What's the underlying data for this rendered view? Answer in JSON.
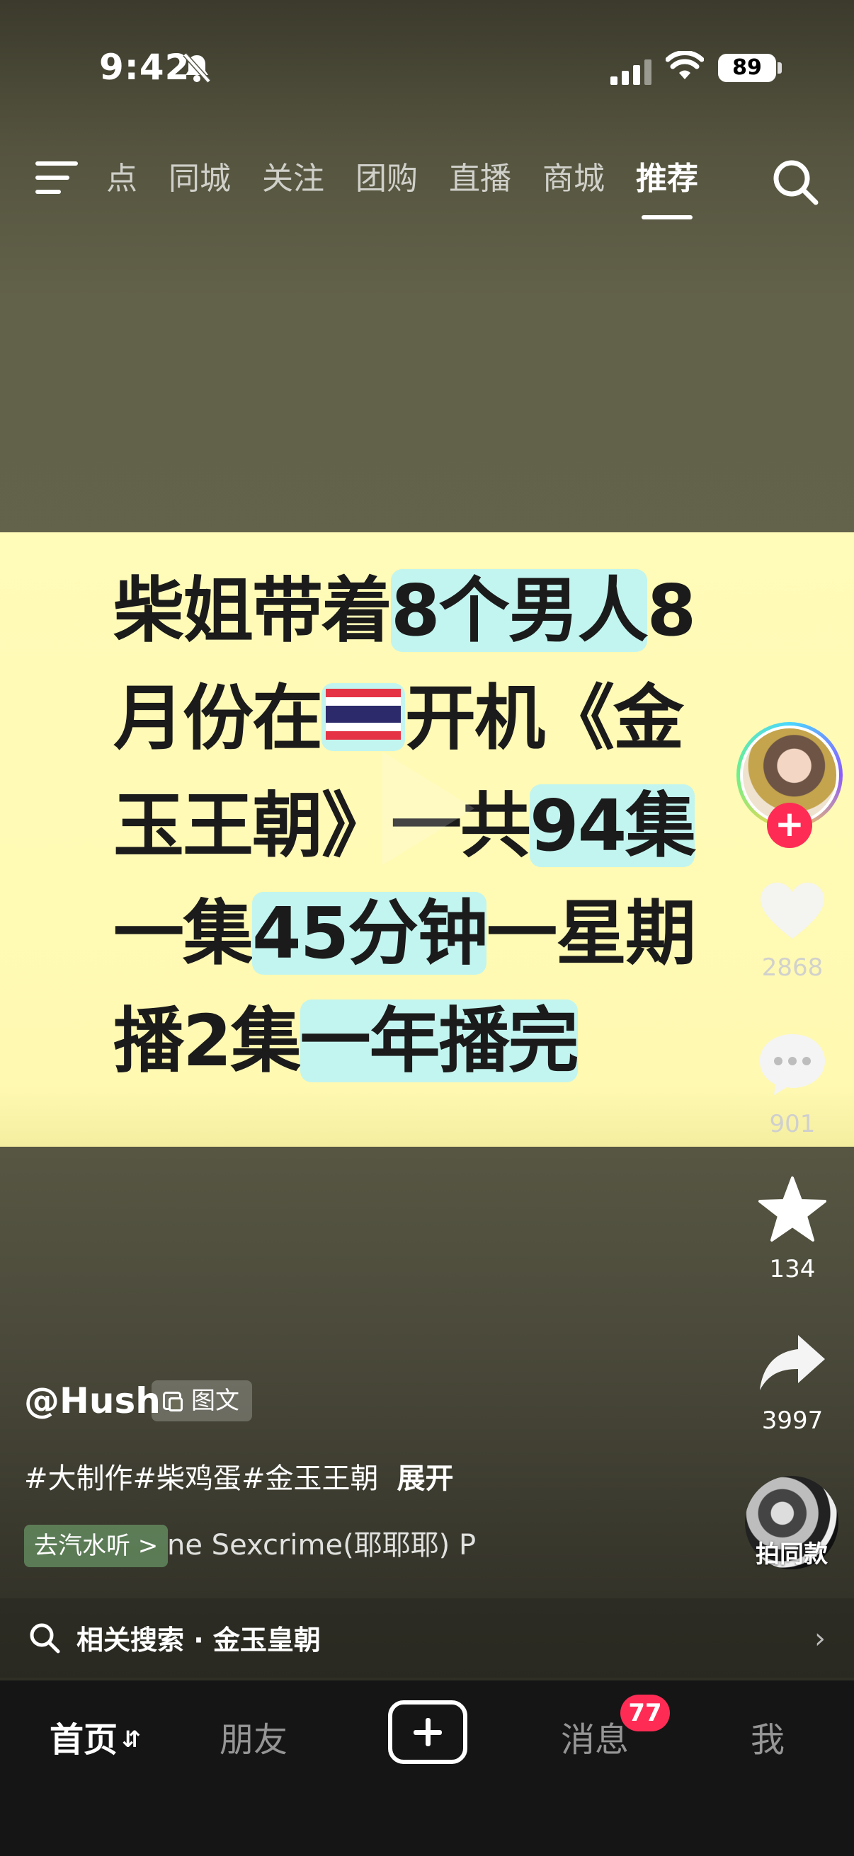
{
  "status_bar": {
    "time": "9:42",
    "battery": "89"
  },
  "top_nav": {
    "tabs": [
      {
        "label": "点"
      },
      {
        "label": "同城"
      },
      {
        "label": "关注"
      },
      {
        "label": "团购"
      },
      {
        "label": "直播"
      },
      {
        "label": "商城"
      },
      {
        "label": "推荐"
      }
    ],
    "active_tab": "推荐"
  },
  "card": {
    "line1_a": "柴姐带着",
    "line1_b": "8个男人",
    "line1_c": "8",
    "line2_a": "月份在",
    "line2_b": "开机《金",
    "line3_a": "玉王朝》一共",
    "line3_b": "94集",
    "line4_a": "一集",
    "line4_b": "45分钟",
    "line4_c": "一星期",
    "line5_a": "播2集",
    "line5_b": "一年播完",
    "colors": {
      "background": "#fff9b2",
      "highlight": "#c2f5ef",
      "text": "#1b1b1b"
    }
  },
  "rail": {
    "likes": "2868",
    "comments": "901",
    "favorites": "134",
    "shares": "3997",
    "same_style": "拍同款",
    "follow": "+"
  },
  "caption": {
    "author": "@Hush",
    "badge": "图文",
    "hashtags": "#大制作#柴鸡蛋#金玉王朝",
    "expand": "展开",
    "go_listen": "去汽水听 >",
    "music": "ne Sexcrime(耶耶耶)   P"
  },
  "related_search": {
    "label": "相关搜索 · 金玉皇朝"
  },
  "bottom_bar": {
    "home": "首页",
    "friends": "朋友",
    "messages": "消息",
    "messages_badge": "77",
    "me": "我"
  },
  "accent_color": "#fe2c55"
}
